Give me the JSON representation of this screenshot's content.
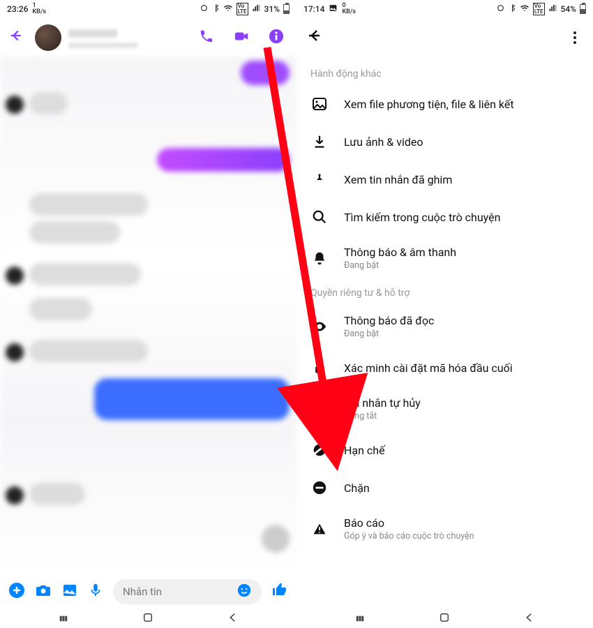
{
  "left": {
    "status": {
      "time": "23:26",
      "speed_num": "1",
      "speed_unit": "KB/s",
      "battery": "31%",
      "battery_level": 31
    },
    "compose_placeholder": "Nhắn tin"
  },
  "right": {
    "status": {
      "time": "17:14",
      "speed_num": "0",
      "speed_unit": "KB/s",
      "battery": "54%",
      "battery_level": 54
    },
    "section1": "Hành động khác",
    "section2": "Quyền riêng tư & hỗ trợ",
    "items": {
      "media": {
        "title": "Xem file phương tiện, file & liên kết"
      },
      "save": {
        "title": "Lưu ảnh & video"
      },
      "pinned": {
        "title": "Xem tin nhắn đã ghim"
      },
      "search": {
        "title": "Tìm kiếm trong cuộc trò chuyện"
      },
      "notif": {
        "title": "Thông báo & âm thanh",
        "sub": "Đang bật"
      },
      "read": {
        "title": "Thông báo đã đọc",
        "sub": "Đang bật"
      },
      "e2e": {
        "title": "Xác minh cài đặt mã hóa đầu cuối"
      },
      "disappear": {
        "title": "Tin nhắn tự hủy",
        "sub": "Đang tắt"
      },
      "restrict": {
        "title": "Hạn chế"
      },
      "block": {
        "title": "Chặn"
      },
      "report": {
        "title": "Báo cáo",
        "sub": "Góp ý và báo cáo cuộc trò chuyện"
      }
    }
  }
}
